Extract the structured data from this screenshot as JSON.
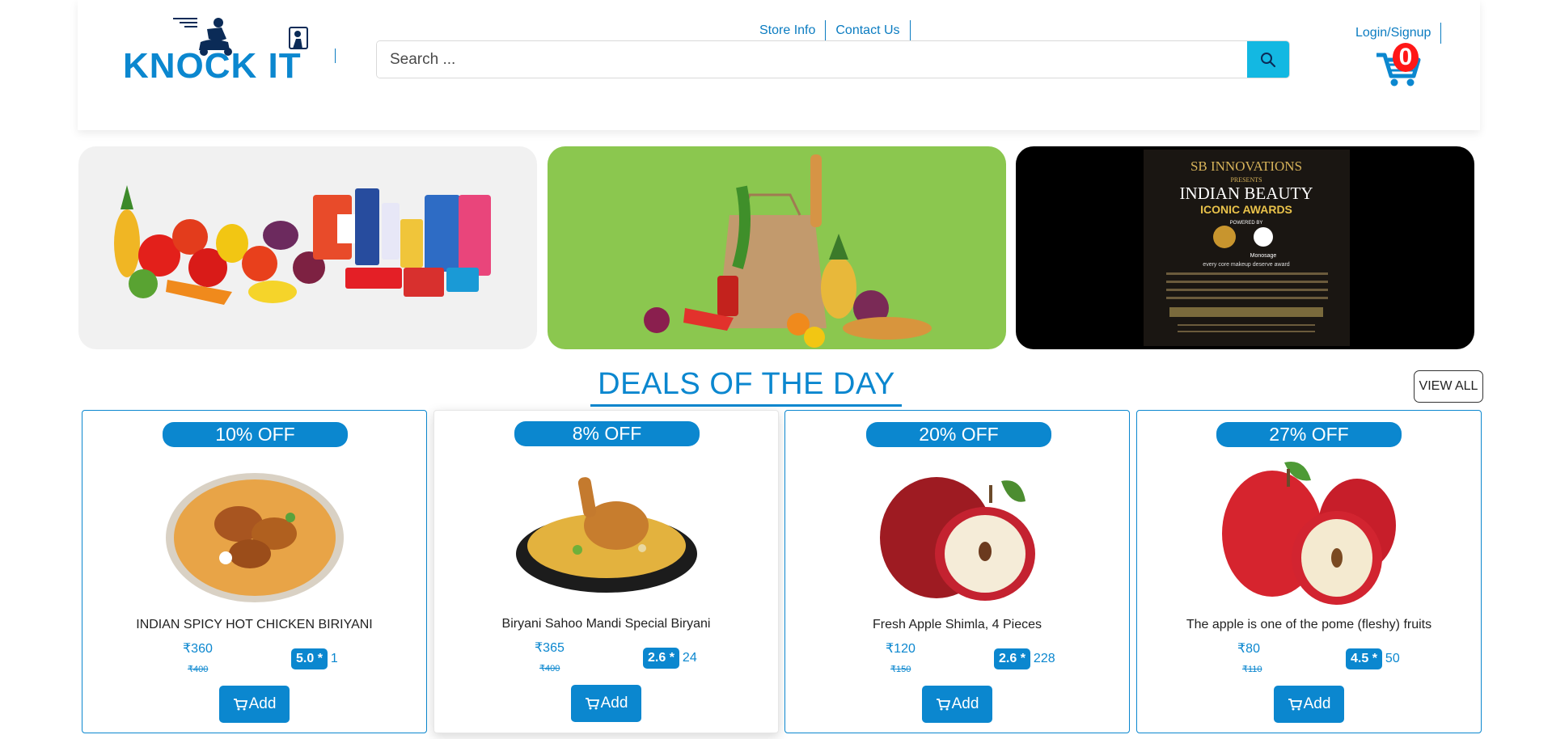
{
  "header": {
    "brand": "KNOCK IT",
    "links": [
      "Store Info",
      "Contact Us"
    ],
    "search_placeholder": "Search ...",
    "login_label": "Login/Signup",
    "cart_count": "0"
  },
  "banners": [
    {
      "name": "groceries-and-vegetables-banner"
    },
    {
      "name": "grocery-bag-banner"
    },
    {
      "name": "indian-beauty-awards-banner",
      "brand": "SB INNOVATIONS",
      "presents": "PRESENTS",
      "title": "INDIAN BEAUTY",
      "subtitle": "ICONIC AWARDS",
      "powered": "POWERED BY",
      "partner": "Monosage",
      "tagline": "every core makeup deserve award"
    }
  ],
  "deals": {
    "title": "DEALS OF THE DAY",
    "view_all_label": "VIEW ALL",
    "add_label": "Add",
    "products": [
      {
        "discount": "10% OFF",
        "name": "INDIAN SPICY HOT CHICKEN BIRIYANI",
        "price": "₹360",
        "mrp": "₹400",
        "rating": "5.0 *",
        "rating_count": "1"
      },
      {
        "discount": "8% OFF",
        "name": "Biryani Sahoo Mandi Special Biryani",
        "price": "₹365",
        "mrp": "₹400",
        "rating": "2.6 *",
        "rating_count": "24"
      },
      {
        "discount": "20% OFF",
        "name": "Fresh Apple Shimla, 4 Pieces",
        "price": "₹120",
        "mrp": "₹150",
        "rating": "2.6 *",
        "rating_count": "228"
      },
      {
        "discount": "27% OFF",
        "name": "The apple is one of the pome (fleshy) fruits",
        "price": "₹80",
        "mrp": "₹110",
        "rating": "4.5 *",
        "rating_count": "50"
      }
    ]
  },
  "colors": {
    "primary": "#0b87cf",
    "search_button": "#13b8e2",
    "cart_badge": "#ff1717",
    "banner_green": "#8bc74f"
  }
}
